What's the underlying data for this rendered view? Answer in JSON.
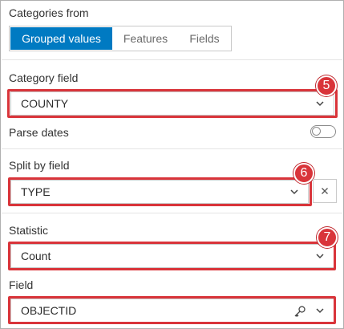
{
  "categories_from": {
    "label": "Categories from",
    "options": [
      "Grouped values",
      "Features",
      "Fields"
    ],
    "selected": "Grouped values"
  },
  "category_field": {
    "label": "Category field",
    "value": "COUNTY"
  },
  "parse_dates": {
    "label": "Parse dates",
    "enabled": false
  },
  "split_by_field": {
    "label": "Split by field",
    "value": "TYPE"
  },
  "statistic": {
    "label": "Statistic",
    "value": "Count"
  },
  "field": {
    "label": "Field",
    "value": "OBJECTID"
  },
  "callouts": [
    "5",
    "6",
    "7"
  ],
  "colors": {
    "accent": "#007ac2",
    "callout": "#d9343a"
  },
  "icons": {
    "dropdown": "chevron-down-icon",
    "clear": "close-icon",
    "key": "key-icon"
  }
}
